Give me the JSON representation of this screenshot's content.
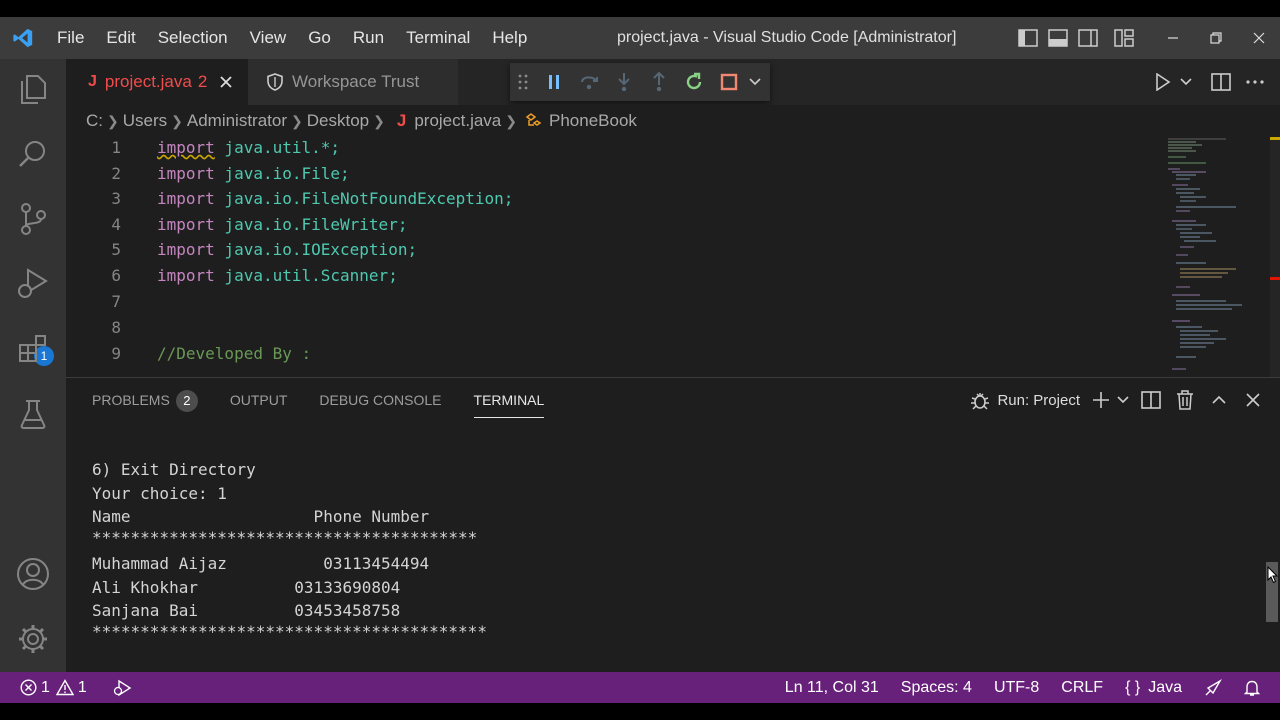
{
  "window": {
    "title": "project.java - Visual Studio Code [Administrator]"
  },
  "menu": [
    "File",
    "Edit",
    "Selection",
    "View",
    "Go",
    "Run",
    "Terminal",
    "Help"
  ],
  "activity": {
    "debug_badge": "1"
  },
  "tabs": {
    "active": {
      "label": "project.java",
      "problems": "2"
    },
    "inactive": {
      "label": "Workspace Trust"
    }
  },
  "breadcrumb": [
    "C:",
    "Users",
    "Administrator",
    "Desktop",
    "project.java",
    "PhoneBook"
  ],
  "code": [
    {
      "n": "1",
      "kw": "import",
      "rest": " java.util.*;"
    },
    {
      "n": "2",
      "kw": "import",
      "rest": " java.io.File;"
    },
    {
      "n": "3",
      "kw": "import",
      "rest": " java.io.FileNotFoundException;"
    },
    {
      "n": "4",
      "kw": "import",
      "rest": " java.io.FileWriter;"
    },
    {
      "n": "5",
      "kw": "import",
      "rest": " java.io.IOException;"
    },
    {
      "n": "6",
      "kw": "import",
      "rest": " java.util.Scanner;"
    },
    {
      "n": "7",
      "kw": "",
      "rest": ""
    },
    {
      "n": "8",
      "kw": "",
      "rest": ""
    },
    {
      "n": "9",
      "kw": "",
      "rest": "//Developed By :"
    }
  ],
  "panel": {
    "tabs": [
      "PROBLEMS",
      "OUTPUT",
      "DEBUG CONSOLE",
      "TERMINAL"
    ],
    "problems_count": "2",
    "run_label": "Run: Project"
  },
  "terminal": [
    "6) Exit Directory",
    "Your choice: 1",
    "Name                   Phone Number",
    "****************************************",
    "Muhammad Aijaz          03113454494",
    "Ali Khokhar          03133690804",
    "Sanjana Bai          03453458758",
    "*****************************************"
  ],
  "status": {
    "errors": "1",
    "warnings": "1",
    "position": "Ln 11, Col 31",
    "spaces": "Spaces: 4",
    "encoding": "UTF-8",
    "eol": "CRLF",
    "language": "Java"
  },
  "colors": {
    "statusbar": "#68217a",
    "accent_tab": "#f14c4c",
    "keyword": "#c586c0",
    "type": "#4ec9b0"
  }
}
